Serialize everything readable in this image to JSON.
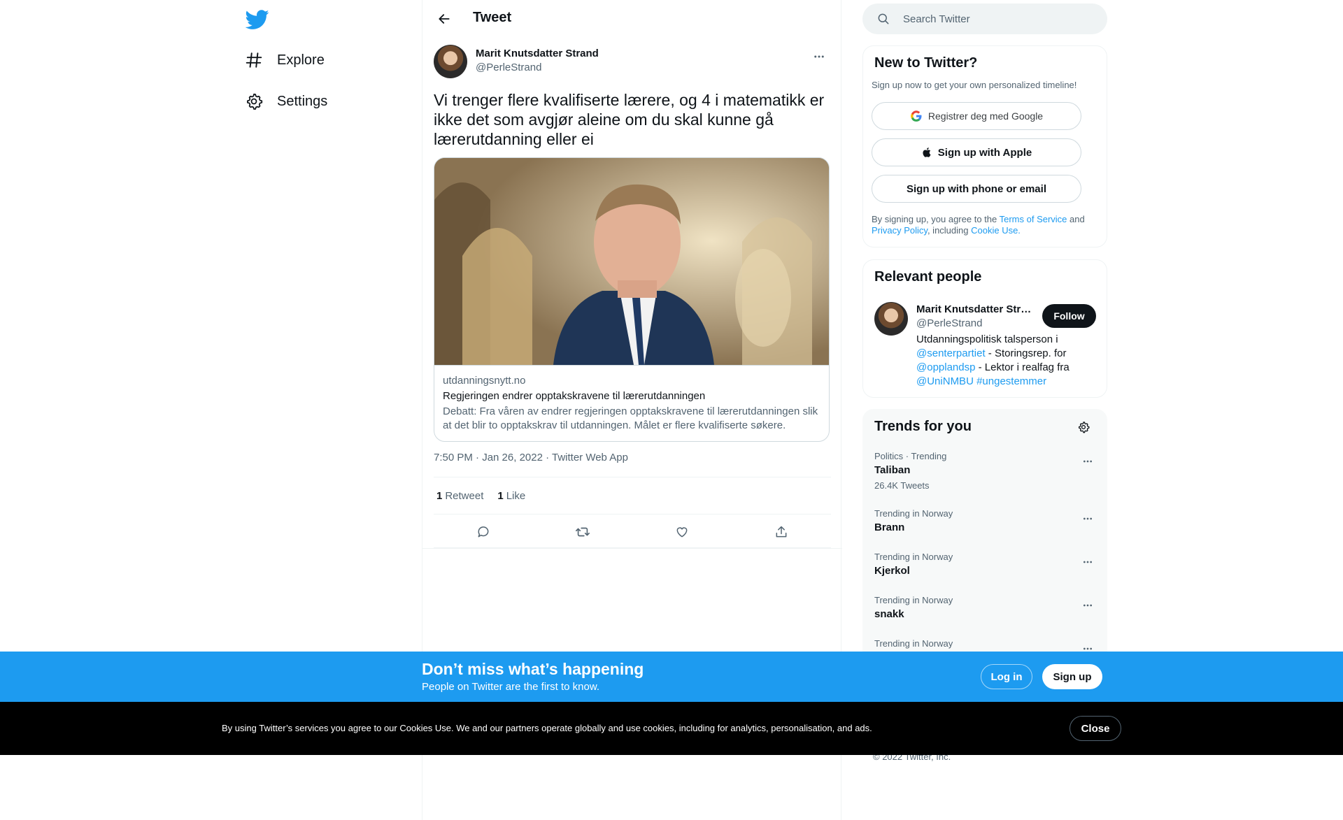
{
  "nav": {
    "logo_icon": "twitter-bird-icon",
    "items": [
      {
        "label": "Explore",
        "icon": "hashtag-icon"
      },
      {
        "label": "Settings",
        "icon": "gear-icon"
      }
    ]
  },
  "header": {
    "title": "Tweet",
    "back_icon": "arrow-left-icon"
  },
  "tweet": {
    "author_name": "Marit Knutsdatter Strand",
    "author_handle": "@PerleStrand",
    "text": "Vi trenger flere kvalifiserte lærere, og 4 i matematikk er ikke det som avgjør aleine om du skal kunne gå lærerutdanning eller ei",
    "card": {
      "domain": "utdanningsnytt.no",
      "title": "Regjeringen endrer opptakskravene til lærerutdanningen",
      "description": "Debatt: Fra våren av endrer regjeringen opptakskravene til lærerutdanningen slik at det blir to opptakskrav til utdanningen. Målet er flere kvalifiserte søkere."
    },
    "timestamp": "7:50 PM · Jan 26, 2022 · Twitter Web App",
    "retweets_count": "1",
    "retweets_label": "Retweet",
    "likes_count": "1",
    "likes_label": "Like"
  },
  "search": {
    "placeholder": "Search Twitter"
  },
  "signup_box": {
    "title": "New to Twitter?",
    "subtitle": "Sign up now to get your own personalized timeline!",
    "google_label": "Registrer deg med Google",
    "apple_label": "Sign up with Apple",
    "phone_label": "Sign up with phone or email",
    "legal_prefix": "By signing up, you agree to the ",
    "terms": "Terms of Service",
    "legal_and": " and ",
    "privacy": "Privacy Policy",
    "legal_including": ", including ",
    "cookie": "Cookie Use."
  },
  "relevant": {
    "title": "Relevant people",
    "name": "Marit Knutsdatter Strand",
    "handle": "@PerleStrand",
    "follow_label": "Follow",
    "bio_1": "Utdanningspolitisk talsperson i ",
    "bio_link_1": "@senterpartiet",
    "bio_2": " - Storingsrep. for ",
    "bio_link_2": "@opplandsp",
    "bio_3": " - Lektor i realfag fra ",
    "bio_link_3": "@UniNMBU",
    "bio_link_4": "#ungestemmer"
  },
  "trends": {
    "title": "Trends for you",
    "items": [
      {
        "context": "Politics · Trending",
        "name": "Taliban",
        "count": "26.4K Tweets"
      },
      {
        "context": "Trending in Norway",
        "name": "Brann",
        "count": ""
      },
      {
        "context": "Trending in Norway",
        "name": "Kjerkol",
        "count": ""
      },
      {
        "context": "Trending in Norway",
        "name": "snakk",
        "count": ""
      },
      {
        "context": "Trending in Norway",
        "name": "",
        "count": ""
      }
    ]
  },
  "footer": {
    "copyright": "© 2022 Twitter, Inc."
  },
  "bottom_bar": {
    "title": "Don’t miss what’s happening",
    "subtitle": "People on Twitter are the first to know.",
    "login": "Log in",
    "signup": "Sign up"
  },
  "cookie_bar": {
    "text": "By using Twitter’s services you agree to our Cookies Use. We and our partners operate globally and use cookies, including for analytics, personalisation, and ads.",
    "close": "Close"
  },
  "colors": {
    "accent": "#1d9bf0",
    "text": "#0f1419",
    "muted": "#536471",
    "border": "#eff3f4"
  }
}
